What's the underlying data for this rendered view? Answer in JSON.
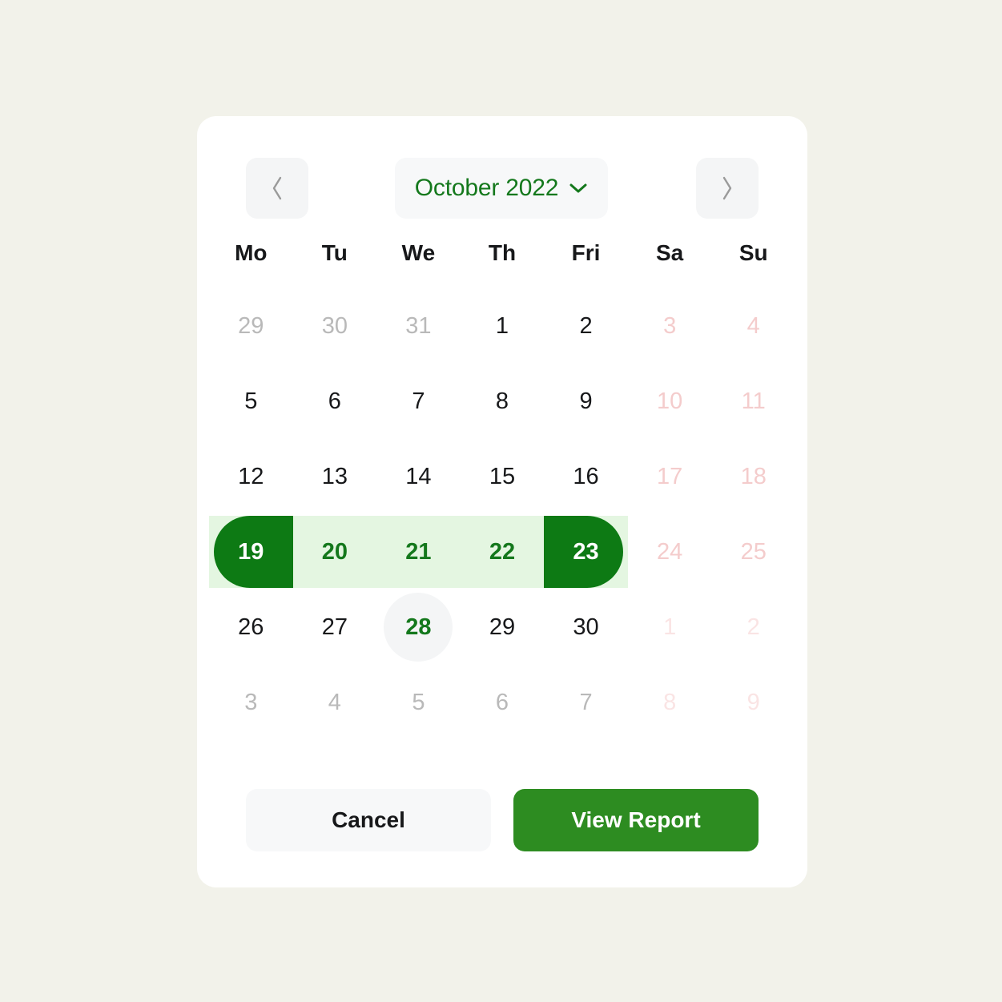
{
  "theme": {
    "page_bg": "#f2f2ea",
    "card_bg": "#ffffff",
    "accent_green": "#14781c",
    "range_endpoint_green": "#0d7a14",
    "range_band_green": "#e4f6e1",
    "primary_button_green": "#2d8c21",
    "weekend_pink": "#f4cccc",
    "muted_grey": "#b9b9b9",
    "control_grey": "#f4f5f6"
  },
  "header": {
    "prev_icon": "chevron-left-icon",
    "next_icon": "chevron-right-icon",
    "month_label": "October 2022",
    "dropdown_icon": "chevron-down-icon"
  },
  "weekdays": [
    "Mo",
    "Tu",
    "We",
    "Th",
    "Fri",
    "Sa",
    "Su"
  ],
  "days": [
    [
      {
        "label": "29",
        "type": "muted"
      },
      {
        "label": "30",
        "type": "muted"
      },
      {
        "label": "31",
        "type": "muted"
      },
      {
        "label": "1",
        "type": "normal"
      },
      {
        "label": "2",
        "type": "normal"
      },
      {
        "label": "3",
        "type": "weekend"
      },
      {
        "label": "4",
        "type": "weekend"
      }
    ],
    [
      {
        "label": "5",
        "type": "normal"
      },
      {
        "label": "6",
        "type": "normal"
      },
      {
        "label": "7",
        "type": "normal"
      },
      {
        "label": "8",
        "type": "normal"
      },
      {
        "label": "9",
        "type": "normal"
      },
      {
        "label": "10",
        "type": "weekend"
      },
      {
        "label": "11",
        "type": "weekend"
      }
    ],
    [
      {
        "label": "12",
        "type": "normal"
      },
      {
        "label": "13",
        "type": "normal"
      },
      {
        "label": "14",
        "type": "normal"
      },
      {
        "label": "15",
        "type": "normal"
      },
      {
        "label": "16",
        "type": "normal"
      },
      {
        "label": "17",
        "type": "weekend"
      },
      {
        "label": "18",
        "type": "weekend"
      }
    ],
    [
      {
        "label": "19",
        "type": "range-start"
      },
      {
        "label": "20",
        "type": "in-range"
      },
      {
        "label": "21",
        "type": "in-range"
      },
      {
        "label": "22",
        "type": "in-range"
      },
      {
        "label": "23",
        "type": "range-end"
      },
      {
        "label": "24",
        "type": "weekend"
      },
      {
        "label": "25",
        "type": "weekend"
      }
    ],
    [
      {
        "label": "26",
        "type": "normal"
      },
      {
        "label": "27",
        "type": "normal"
      },
      {
        "label": "28",
        "type": "today"
      },
      {
        "label": "29",
        "type": "normal"
      },
      {
        "label": "30",
        "type": "normal"
      },
      {
        "label": "1",
        "type": "weekend-muted"
      },
      {
        "label": "2",
        "type": "weekend-muted"
      }
    ],
    [
      {
        "label": "3",
        "type": "muted"
      },
      {
        "label": "4",
        "type": "muted"
      },
      {
        "label": "5",
        "type": "muted"
      },
      {
        "label": "6",
        "type": "muted"
      },
      {
        "label": "7",
        "type": "muted"
      },
      {
        "label": "8",
        "type": "weekend-muted"
      },
      {
        "label": "9",
        "type": "weekend-muted"
      }
    ]
  ],
  "selection": {
    "start_day": "19",
    "end_day": "23",
    "today": "28"
  },
  "footer": {
    "cancel_label": "Cancel",
    "submit_label": "View Report"
  }
}
